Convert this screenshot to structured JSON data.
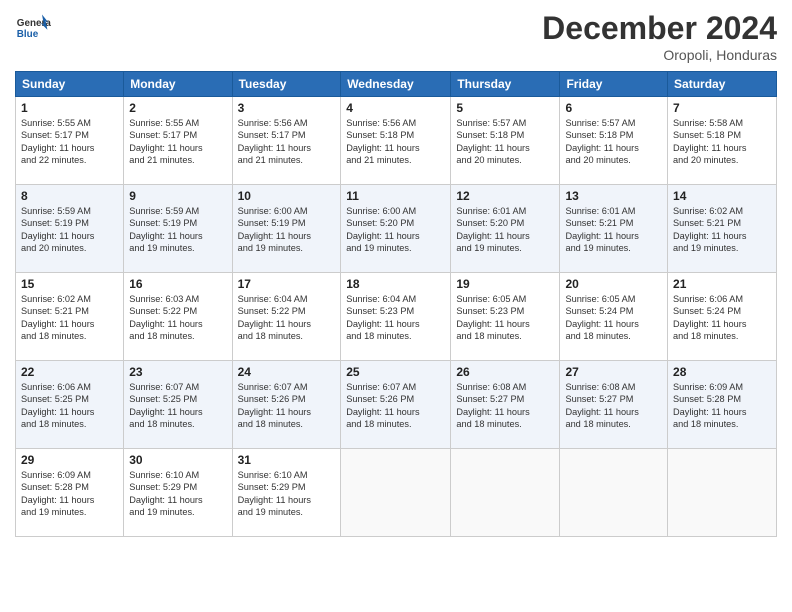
{
  "header": {
    "logo_general": "General",
    "logo_blue": "Blue",
    "month_title": "December 2024",
    "location": "Oropoli, Honduras"
  },
  "calendar": {
    "days_of_week": [
      "Sunday",
      "Monday",
      "Tuesday",
      "Wednesday",
      "Thursday",
      "Friday",
      "Saturday"
    ],
    "weeks": [
      [
        {
          "day": "",
          "info": ""
        },
        {
          "day": "2",
          "info": "Sunrise: 5:55 AM\nSunset: 5:17 PM\nDaylight: 11 hours\nand 21 minutes."
        },
        {
          "day": "3",
          "info": "Sunrise: 5:56 AM\nSunset: 5:17 PM\nDaylight: 11 hours\nand 21 minutes."
        },
        {
          "day": "4",
          "info": "Sunrise: 5:56 AM\nSunset: 5:18 PM\nDaylight: 11 hours\nand 21 minutes."
        },
        {
          "day": "5",
          "info": "Sunrise: 5:57 AM\nSunset: 5:18 PM\nDaylight: 11 hours\nand 20 minutes."
        },
        {
          "day": "6",
          "info": "Sunrise: 5:57 AM\nSunset: 5:18 PM\nDaylight: 11 hours\nand 20 minutes."
        },
        {
          "day": "7",
          "info": "Sunrise: 5:58 AM\nSunset: 5:18 PM\nDaylight: 11 hours\nand 20 minutes."
        }
      ],
      [
        {
          "day": "8",
          "info": "Sunrise: 5:59 AM\nSunset: 5:19 PM\nDaylight: 11 hours\nand 20 minutes."
        },
        {
          "day": "9",
          "info": "Sunrise: 5:59 AM\nSunset: 5:19 PM\nDaylight: 11 hours\nand 19 minutes."
        },
        {
          "day": "10",
          "info": "Sunrise: 6:00 AM\nSunset: 5:19 PM\nDaylight: 11 hours\nand 19 minutes."
        },
        {
          "day": "11",
          "info": "Sunrise: 6:00 AM\nSunset: 5:20 PM\nDaylight: 11 hours\nand 19 minutes."
        },
        {
          "day": "12",
          "info": "Sunrise: 6:01 AM\nSunset: 5:20 PM\nDaylight: 11 hours\nand 19 minutes."
        },
        {
          "day": "13",
          "info": "Sunrise: 6:01 AM\nSunset: 5:21 PM\nDaylight: 11 hours\nand 19 minutes."
        },
        {
          "day": "14",
          "info": "Sunrise: 6:02 AM\nSunset: 5:21 PM\nDaylight: 11 hours\nand 19 minutes."
        }
      ],
      [
        {
          "day": "15",
          "info": "Sunrise: 6:02 AM\nSunset: 5:21 PM\nDaylight: 11 hours\nand 18 minutes."
        },
        {
          "day": "16",
          "info": "Sunrise: 6:03 AM\nSunset: 5:22 PM\nDaylight: 11 hours\nand 18 minutes."
        },
        {
          "day": "17",
          "info": "Sunrise: 6:04 AM\nSunset: 5:22 PM\nDaylight: 11 hours\nand 18 minutes."
        },
        {
          "day": "18",
          "info": "Sunrise: 6:04 AM\nSunset: 5:23 PM\nDaylight: 11 hours\nand 18 minutes."
        },
        {
          "day": "19",
          "info": "Sunrise: 6:05 AM\nSunset: 5:23 PM\nDaylight: 11 hours\nand 18 minutes."
        },
        {
          "day": "20",
          "info": "Sunrise: 6:05 AM\nSunset: 5:24 PM\nDaylight: 11 hours\nand 18 minutes."
        },
        {
          "day": "21",
          "info": "Sunrise: 6:06 AM\nSunset: 5:24 PM\nDaylight: 11 hours\nand 18 minutes."
        }
      ],
      [
        {
          "day": "22",
          "info": "Sunrise: 6:06 AM\nSunset: 5:25 PM\nDaylight: 11 hours\nand 18 minutes."
        },
        {
          "day": "23",
          "info": "Sunrise: 6:07 AM\nSunset: 5:25 PM\nDaylight: 11 hours\nand 18 minutes."
        },
        {
          "day": "24",
          "info": "Sunrise: 6:07 AM\nSunset: 5:26 PM\nDaylight: 11 hours\nand 18 minutes."
        },
        {
          "day": "25",
          "info": "Sunrise: 6:07 AM\nSunset: 5:26 PM\nDaylight: 11 hours\nand 18 minutes."
        },
        {
          "day": "26",
          "info": "Sunrise: 6:08 AM\nSunset: 5:27 PM\nDaylight: 11 hours\nand 18 minutes."
        },
        {
          "day": "27",
          "info": "Sunrise: 6:08 AM\nSunset: 5:27 PM\nDaylight: 11 hours\nand 18 minutes."
        },
        {
          "day": "28",
          "info": "Sunrise: 6:09 AM\nSunset: 5:28 PM\nDaylight: 11 hours\nand 18 minutes."
        }
      ],
      [
        {
          "day": "29",
          "info": "Sunrise: 6:09 AM\nSunset: 5:28 PM\nDaylight: 11 hours\nand 19 minutes."
        },
        {
          "day": "30",
          "info": "Sunrise: 6:10 AM\nSunset: 5:29 PM\nDaylight: 11 hours\nand 19 minutes."
        },
        {
          "day": "31",
          "info": "Sunrise: 6:10 AM\nSunset: 5:29 PM\nDaylight: 11 hours\nand 19 minutes."
        },
        {
          "day": "",
          "info": ""
        },
        {
          "day": "",
          "info": ""
        },
        {
          "day": "",
          "info": ""
        },
        {
          "day": "",
          "info": ""
        }
      ]
    ],
    "week1_day1": {
      "day": "1",
      "info": "Sunrise: 5:55 AM\nSunset: 5:17 PM\nDaylight: 11 hours\nand 22 minutes."
    }
  }
}
